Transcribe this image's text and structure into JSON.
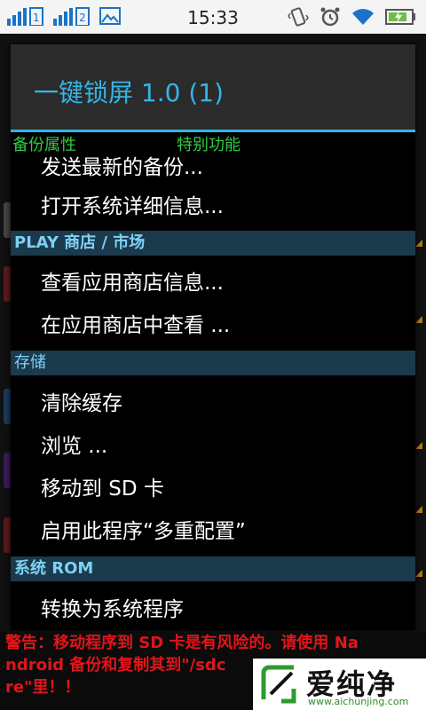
{
  "status_bar": {
    "time": "15:33",
    "left_icons": [
      "signal-1-icon",
      "signal-2-icon",
      "image-icon"
    ],
    "right_icons": [
      "vibrate-icon",
      "alarm-icon",
      "wifi-icon",
      "battery-charging-icon"
    ]
  },
  "dialog": {
    "title": "一键锁屏 1.0 (1)",
    "tabs": {
      "left": "备份属性",
      "right": "特别功能"
    },
    "items": [
      {
        "type": "item",
        "label": "发送最新的备份..."
      },
      {
        "type": "item",
        "label": "打开系统详细信息..."
      },
      {
        "type": "section",
        "label": "PLAY 商店 / 市场"
      },
      {
        "type": "item",
        "label": "查看应用商店信息..."
      },
      {
        "type": "item",
        "label": "在应用商店中查看 ..."
      },
      {
        "type": "section",
        "label": "存储"
      },
      {
        "type": "item",
        "label": "清除缓存"
      },
      {
        "type": "item",
        "label": "浏览 ..."
      },
      {
        "type": "item",
        "label": "移动到 SD 卡"
      },
      {
        "type": "item",
        "label": "启用此程序“多重配置”"
      },
      {
        "type": "section",
        "label": "系统 ROM"
      },
      {
        "type": "item",
        "label": "转换为系统程序"
      }
    ]
  },
  "warning": {
    "line1": "警告：移动程序到 SD 卡是有风险的。请使用 Na",
    "line2": "ndroid 备份和复制其到\"/sdc",
    "line3": "re\"里！！"
  },
  "watermark": {
    "text": "爱纯净",
    "url": "www.aichunjing.com"
  },
  "colors": {
    "accent": "#33b5e5",
    "tab_green": "#2ecc40",
    "section_bg": "#1b3a4b",
    "warning_red": "#e0151b"
  }
}
